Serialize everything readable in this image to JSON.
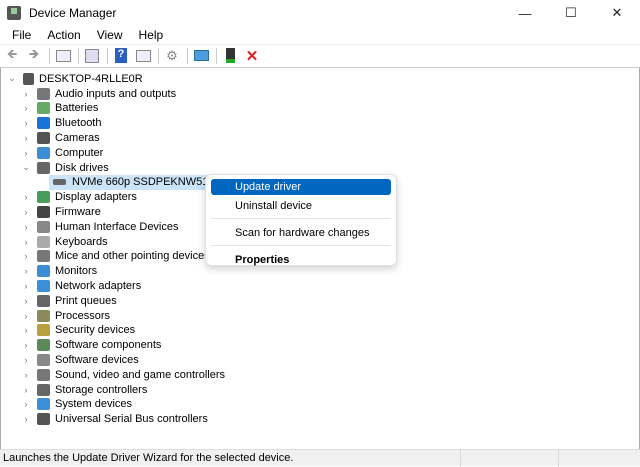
{
  "window": {
    "title": "Device Manager",
    "minimize": "—",
    "maximize": "☐",
    "close": "✕"
  },
  "menu": [
    "File",
    "Action",
    "View",
    "Help"
  ],
  "toolbar": [
    "back-icon",
    "forward-icon",
    "show-hide-console-tree-icon",
    "properties-icon",
    "help-icon",
    "action-pane-icon",
    "scan-hardware-icon",
    "monitor-icon",
    "update-driver-icon",
    "uninstall-icon"
  ],
  "tree": {
    "root": "DESKTOP-4RLLE0R",
    "items": [
      {
        "label": "Audio inputs and outputs",
        "color": "#777"
      },
      {
        "label": "Batteries",
        "color": "#6a6"
      },
      {
        "label": "Bluetooth",
        "color": "#1a73d9"
      },
      {
        "label": "Cameras",
        "color": "#555"
      },
      {
        "label": "Computer",
        "color": "#3a8fd6"
      },
      {
        "label": "Disk drives",
        "color": "#666",
        "expanded": true,
        "children": [
          "NVMe 660p SSDPEKNW512G8 N"
        ]
      },
      {
        "label": "Display adapters",
        "color": "#4a9c5a"
      },
      {
        "label": "Firmware",
        "color": "#444"
      },
      {
        "label": "Human Interface Devices",
        "color": "#888"
      },
      {
        "label": "Keyboards",
        "color": "#aaa"
      },
      {
        "label": "Mice and other pointing devices",
        "color": "#777"
      },
      {
        "label": "Monitors",
        "color": "#3a8fd6"
      },
      {
        "label": "Network adapters",
        "color": "#3a8fd6"
      },
      {
        "label": "Print queues",
        "color": "#666"
      },
      {
        "label": "Processors",
        "color": "#8a8a5a"
      },
      {
        "label": "Security devices",
        "color": "#b8a040"
      },
      {
        "label": "Software components",
        "color": "#5a8a5a"
      },
      {
        "label": "Software devices",
        "color": "#888"
      },
      {
        "label": "Sound, video and game controllers",
        "color": "#777"
      },
      {
        "label": "Storage controllers",
        "color": "#666"
      },
      {
        "label": "System devices",
        "color": "#3a8fd6"
      },
      {
        "label": "Universal Serial Bus controllers",
        "color": "#555"
      }
    ]
  },
  "context_menu": {
    "items": [
      "Update driver",
      "Uninstall device",
      "Scan for hardware changes",
      "Properties"
    ],
    "highlighted": "Update driver"
  },
  "status": "Launches the Update Driver Wizard for the selected device."
}
